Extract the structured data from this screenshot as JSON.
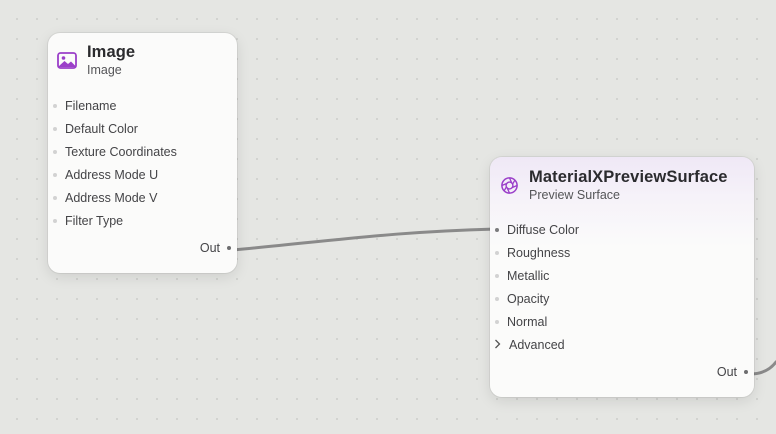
{
  "canvas": {
    "background": "#e5e6e3",
    "grid_dots": true
  },
  "nodes": {
    "image": {
      "title": "Image",
      "subtitle": "Image",
      "icon": "photo-icon",
      "accent": "#9b3fc9",
      "inputs": [
        {
          "label": "Filename",
          "connected": false
        },
        {
          "label": "Default Color",
          "connected": false
        },
        {
          "label": "Texture Coordinates",
          "connected": false
        },
        {
          "label": "Address Mode U",
          "connected": false
        },
        {
          "label": "Address Mode V",
          "connected": false
        },
        {
          "label": "Filter Type",
          "connected": false
        }
      ],
      "output": {
        "label": "Out",
        "connected": true
      }
    },
    "surface": {
      "title": "MaterialXPreviewSurface",
      "subtitle": "Preview Surface",
      "icon": "aperture-icon",
      "accent": "#9b3fc9",
      "inputs": [
        {
          "label": "Diffuse Color",
          "connected": true
        },
        {
          "label": "Roughness",
          "connected": false
        },
        {
          "label": "Metallic",
          "connected": false
        },
        {
          "label": "Opacity",
          "connected": false
        },
        {
          "label": "Normal",
          "connected": false
        }
      ],
      "group": {
        "label": "Advanced",
        "expanded": false,
        "icon": "chevron-right-icon"
      },
      "output": {
        "label": "Out",
        "connected": true
      }
    }
  },
  "wire_color": "#8a8a8a"
}
